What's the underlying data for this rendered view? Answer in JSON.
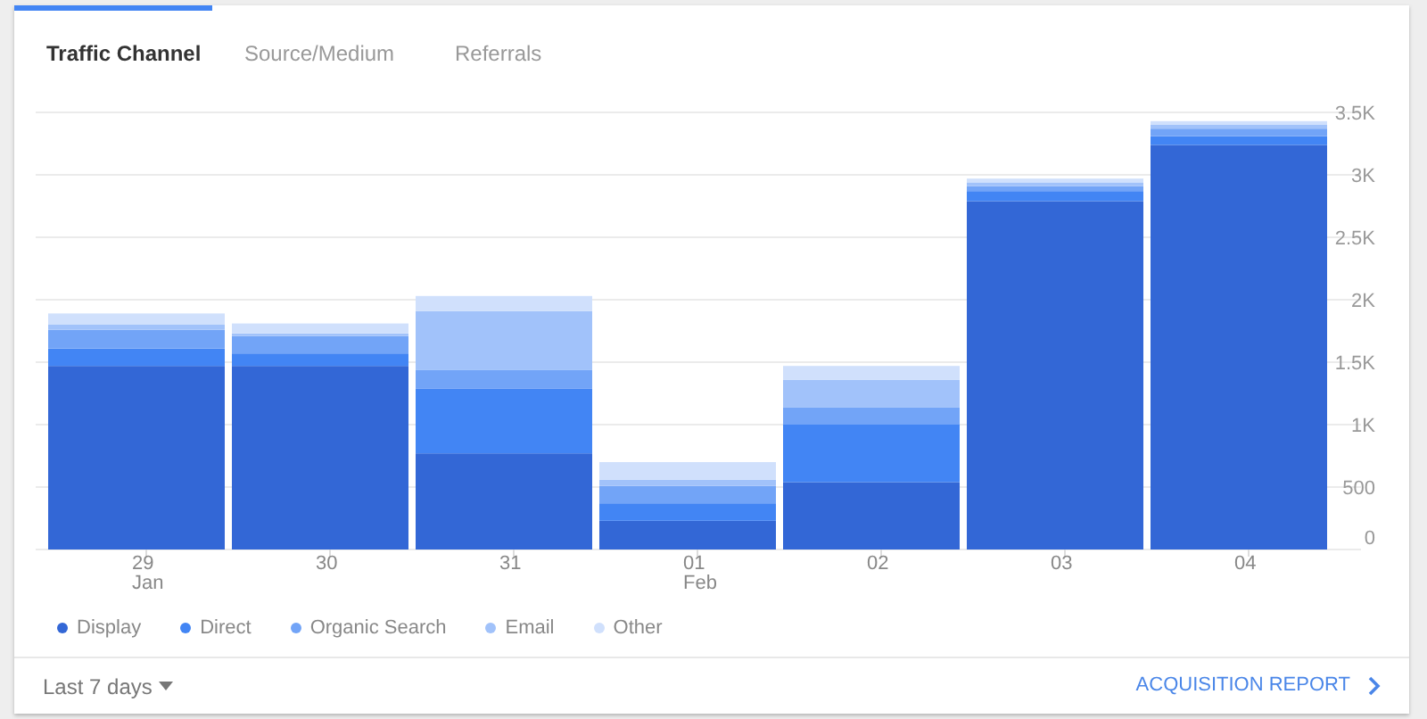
{
  "tabs": [
    {
      "label": "Traffic Channel",
      "selected": true
    },
    {
      "label": "Source/Medium",
      "selected": false
    },
    {
      "label": "Referrals",
      "selected": false
    }
  ],
  "chart_data": {
    "type": "bar",
    "stacked": true,
    "categories": [
      "29 Jan",
      "30",
      "31",
      "01 Feb",
      "02",
      "03",
      "04"
    ],
    "series": [
      {
        "name": "Display",
        "color": "#3367d6",
        "values": [
          1470,
          1470,
          770,
          230,
          540,
          2790,
          3240
        ]
      },
      {
        "name": "Direct",
        "color": "#4285f4",
        "values": [
          140,
          100,
          520,
          140,
          460,
          80,
          70
        ]
      },
      {
        "name": "Organic Search",
        "color": "#72a4f7",
        "values": [
          150,
          140,
          150,
          140,
          140,
          40,
          60
        ]
      },
      {
        "name": "Email",
        "color": "#a1c2fa",
        "values": [
          40,
          20,
          470,
          50,
          220,
          30,
          30
        ]
      },
      {
        "name": "Other",
        "color": "#d0e0fc",
        "values": [
          90,
          80,
          120,
          140,
          110,
          30,
          30
        ]
      }
    ],
    "ylim": [
      0,
      3500
    ],
    "grid": true,
    "yticks": [
      0,
      500,
      {
        "value": 1000,
        "label": "1K"
      },
      {
        "value": 1500,
        "label": "1.5K"
      },
      {
        "value": 2000,
        "label": "2K"
      },
      {
        "value": 2500,
        "label": "2.5K"
      },
      {
        "value": 3000,
        "label": "3K"
      },
      {
        "value": 3500,
        "label": "3.5K"
      }
    ]
  },
  "footer": {
    "range": "Last 7 days",
    "link": "ACQUISITION REPORT"
  }
}
